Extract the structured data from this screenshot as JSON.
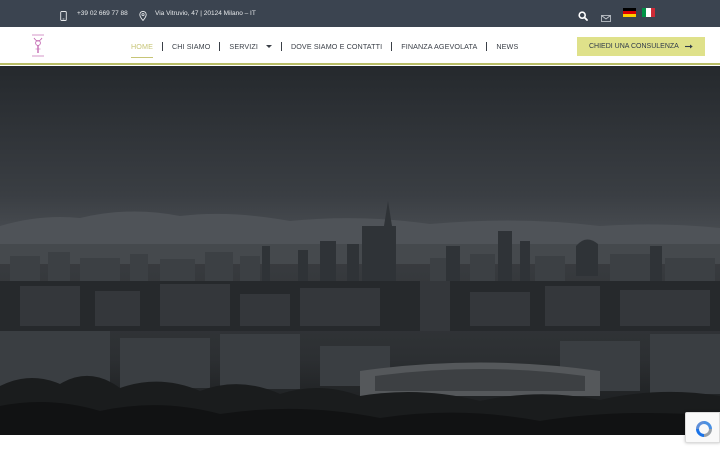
{
  "topbar": {
    "phone": "+39 02 669 77 88",
    "address": "Via Vitruvio, 47 | 20124 Milano – IT",
    "icons": {
      "phone": "phone-icon",
      "location": "location-pin-icon",
      "search": "search-icon",
      "mail": "mail-icon"
    },
    "languages": [
      "de",
      "it"
    ]
  },
  "header": {
    "logo_icon": "logo-icon",
    "nav": [
      {
        "label": "HOME",
        "active": true
      },
      {
        "label": "CHI SIAMO",
        "active": false
      },
      {
        "label": "SERVIZI",
        "active": false,
        "dropdown": true
      },
      {
        "label": "DOVE SIAMO E CONTATTI",
        "active": false
      },
      {
        "label": "FINANZA AGEVOLATA",
        "active": false
      },
      {
        "label": "NEWS",
        "active": false
      }
    ],
    "cta_label": "CHIEDI UNA CONSULENZA",
    "cta_icon": "arrow-right-icon"
  },
  "hero": {
    "image": "milan-skyline-dark"
  },
  "colors": {
    "topbar": "#3b4450",
    "accent": "#c7c576",
    "cta_bg": "#dfe18a",
    "nav_text": "#3a3f47",
    "logo": "#c46bb3"
  },
  "recaptcha": {
    "icon": "recaptcha-icon"
  }
}
